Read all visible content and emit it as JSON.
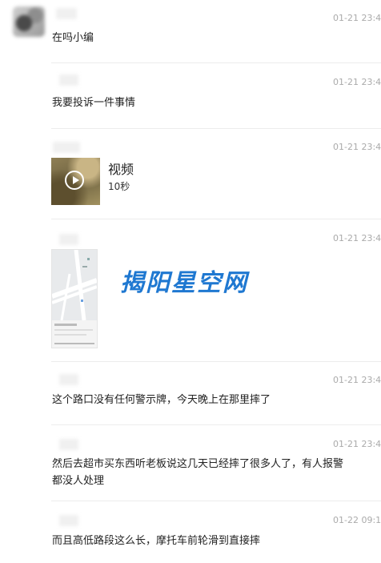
{
  "messages": [
    {
      "time": "01-21 23:41",
      "text": "在吗小编"
    },
    {
      "time": "01-21 23:41",
      "text": "我要投诉一件事情"
    },
    {
      "time": "01-21 23:41",
      "video": {
        "title": "视频",
        "duration": "10秒"
      }
    },
    {
      "time": "01-21 23:42",
      "image": {
        "watermark": "揭阳星空网"
      }
    },
    {
      "time": "01-21 23:42",
      "text": "这个路口没有任何警示牌，今天晚上在那里摔了"
    },
    {
      "time": "01-21 23:43",
      "text_line1": "然后去超市买东西听老板说这几天已经摔了很多人了，有人报警",
      "text_line2": "都没人处理"
    },
    {
      "time": "01-22 09:11",
      "text": "而且高低路段这么长，摩托车前轮滑到直接摔"
    }
  ]
}
